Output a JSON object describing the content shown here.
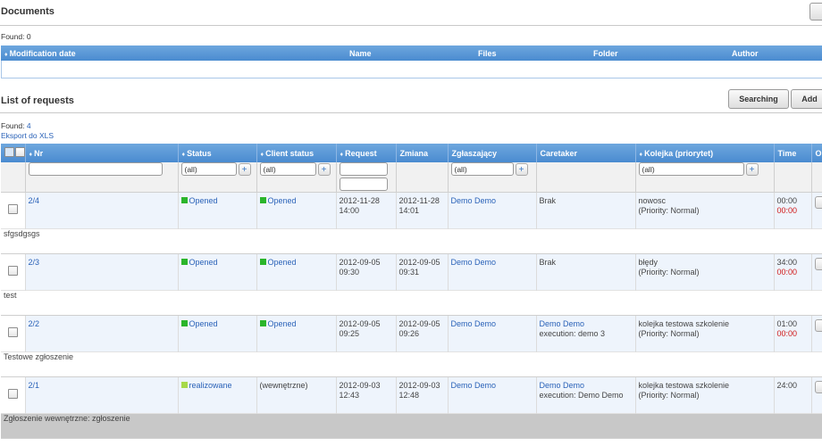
{
  "documents": {
    "title": "Documents",
    "found_label": "Found:",
    "found_count": "0",
    "columns": [
      "Modification date",
      "Name",
      "Files",
      "Folder",
      "Author"
    ]
  },
  "requests": {
    "title": "List of requests",
    "found_label": "Found:",
    "found_count": "4",
    "export_link": "Eksport do XLS",
    "search_button": "Searching",
    "add_button": "Add",
    "columns": [
      "Nr",
      "Status",
      "Client status",
      "Request",
      "Zmiana",
      "Zgłaszający",
      "Caretaker",
      "Kolejka (priorytet)",
      "Time",
      "O"
    ],
    "filters": {
      "status": "(all)",
      "client_status": "(all)",
      "zglaszajacy": "(all)",
      "kolejka": "(all)",
      "plus": "+"
    },
    "rows": [
      {
        "nr": "2/4",
        "status": "Opened",
        "status_color": "#2bb52b",
        "client_status": "Opened",
        "client_status_color": "#2bb52b",
        "request_date": "2012-11-28",
        "request_time": "14:00",
        "change_date": "2012-11-28",
        "change_time": "14:01",
        "reporter": "Demo Demo",
        "caretaker": "Brak",
        "caretaker_exec": "",
        "queue": "nowosc",
        "priority": "(Priority: Normal)",
        "time1": "00:00",
        "time2": "00:00",
        "description": "sfgsdgsgs"
      },
      {
        "nr": "2/3",
        "status": "Opened",
        "status_color": "#2bb52b",
        "client_status": "Opened",
        "client_status_color": "#2bb52b",
        "request_date": "2012-09-05",
        "request_time": "09:30",
        "change_date": "2012-09-05",
        "change_time": "09:31",
        "reporter": "Demo Demo",
        "caretaker": "Brak",
        "caretaker_exec": "",
        "queue": "błędy",
        "priority": "(Priority: Normal)",
        "time1": "34:00",
        "time2": "00:00",
        "description": "test"
      },
      {
        "nr": "2/2",
        "status": "Opened",
        "status_color": "#2bb52b",
        "client_status": "Opened",
        "client_status_color": "#2bb52b",
        "request_date": "2012-09-05",
        "request_time": "09:25",
        "change_date": "2012-09-05",
        "change_time": "09:26",
        "reporter": "Demo Demo",
        "caretaker": "Demo Demo",
        "caretaker_exec": "execution: demo 3",
        "queue": "kolejka testowa szkolenie",
        "priority": "(Priority: Normal)",
        "time1": "01:00",
        "time2": "00:00",
        "description": "Testowe zgłoszenie"
      },
      {
        "nr": "2/1",
        "status": "realizowane",
        "status_color": "#a7d94a",
        "client_status": "(wewnętrzne)",
        "client_status_color": "",
        "request_date": "2012-09-03",
        "request_time": "12:43",
        "change_date": "2012-09-03",
        "change_time": "12:48",
        "reporter": "Demo Demo",
        "caretaker": "Demo Demo",
        "caretaker_exec": "execution: Demo Demo",
        "queue": "kolejka testowa szkolenie",
        "priority": "(Priority: Normal)",
        "time1": "24:00",
        "time2": "",
        "description": "Zgłoszenie wewnętrzne: zgłoszenie"
      }
    ]
  }
}
